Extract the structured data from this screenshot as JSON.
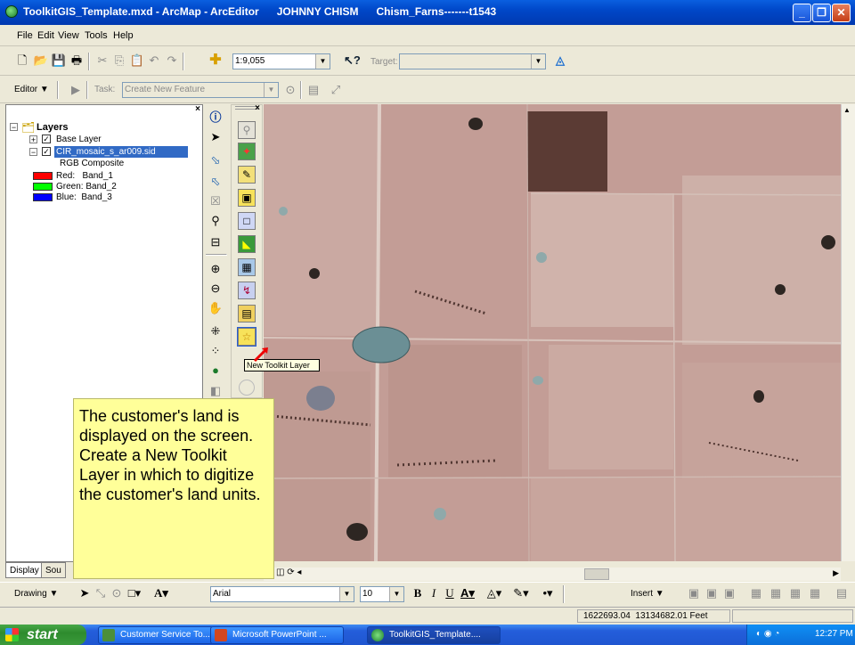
{
  "window": {
    "title": "ToolkitGIS_Template.mxd - ArcMap - ArcEditor      JOHNNY CHISM      Chism_Farns-------t1543"
  },
  "menu": {
    "items": [
      "File",
      "Edit",
      "View",
      "Tools",
      "Help"
    ]
  },
  "standard_toolbar": {
    "scale": "1:9,055",
    "target_label": "Target:"
  },
  "editor_toolbar": {
    "editor_label": "Editor",
    "task_label": "Task:",
    "task_value": "Create New Feature"
  },
  "toc": {
    "root": "Layers",
    "layers": [
      {
        "name": "Base Layer",
        "checked": true,
        "expanded": false,
        "selected": false
      },
      {
        "name": "CIR_mosaic_s_ar009.sid",
        "checked": true,
        "expanded": true,
        "selected": true
      }
    ],
    "composite_label": "RGB Composite",
    "bands": [
      {
        "label": "Red:   Band_1",
        "color": "#ff0000"
      },
      {
        "label": "Green: Band_2",
        "color": "#00ff00"
      },
      {
        "label": "Blue:  Band_3",
        "color": "#0000ff"
      }
    ],
    "tabs": [
      "Display",
      "Sou"
    ]
  },
  "tooltip": {
    "text": "New Toolkit Layer"
  },
  "callout": {
    "text": "The customer's land is displayed on the screen. Create a New Toolkit Layer in which to digitize the customer's land units."
  },
  "drawing_toolbar": {
    "drawing_label": "Drawing",
    "font_name": "Arial",
    "font_size": "10",
    "insert_label": "Insert"
  },
  "status": {
    "coordinates": "1622693.04  13134682.01 Feet"
  },
  "taskbar": {
    "start_label": "start",
    "tasks": [
      "Customer Service To...",
      "Microsoft PowerPoint ...",
      "ToolkitGIS_Template...."
    ],
    "clock": "12:27 PM"
  },
  "colors": {
    "titlebar": "#0a5fe0",
    "callout": "#ffff99",
    "selected_layer": "#316ac5",
    "taskbar": "#245edb",
    "start": "#3b9b3b"
  }
}
